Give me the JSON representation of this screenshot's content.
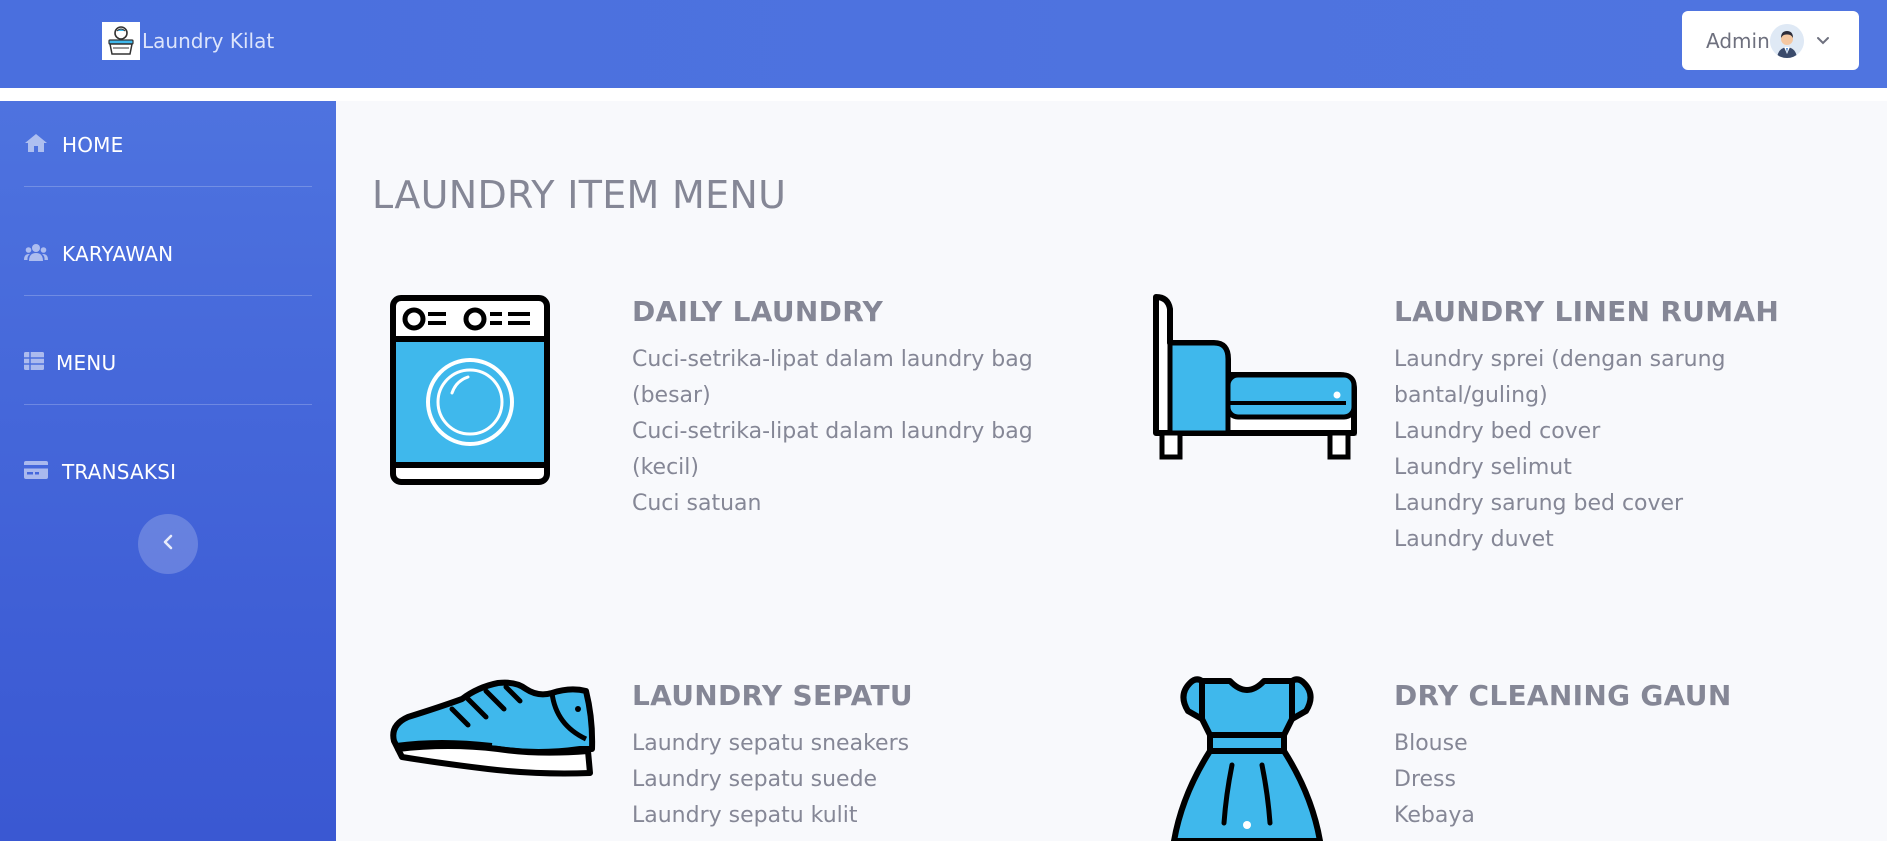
{
  "app": {
    "brand_name": "Laundry Kilat",
    "brand_icon": "laundry-basket-logo"
  },
  "topbar": {
    "user_name": "Admin",
    "avatar_icon": "user-avatar-icon",
    "caret_icon": "chevron-down-icon"
  },
  "sidebar": {
    "items": [
      {
        "label": "HOME",
        "icon": "home-icon"
      },
      {
        "label": "KARYAWAN",
        "icon": "users-icon"
      },
      {
        "label": "MENU",
        "icon": "table-icon"
      },
      {
        "label": "TRANSAKSI",
        "icon": "credit-card-icon"
      }
    ],
    "toggle_icon": "chevron-left-icon"
  },
  "main": {
    "title": "LAUNDRY ITEM MENU",
    "cards": [
      {
        "title": "DAILY LAUNDRY",
        "icon": "washing-machine-icon",
        "items": [
          "Cuci-setrika-lipat dalam laundry bag (besar)",
          "Cuci-setrika-lipat dalam laundry bag (kecil)",
          "Cuci satuan"
        ]
      },
      {
        "title": "LAUNDRY LINEN RUMAH",
        "icon": "bed-icon",
        "items": [
          "Laundry sprei (dengan sarung bantal/guling)",
          "Laundry bed cover",
          "Laundry selimut",
          "Laundry sarung bed cover",
          "Laundry duvet"
        ]
      },
      {
        "title": "LAUNDRY SEPATU",
        "icon": "sneaker-icon",
        "items": [
          "Laundry sepatu sneakers",
          "Laundry sepatu suede",
          "Laundry sepatu kulit"
        ]
      },
      {
        "title": "DRY CLEANING GAUN",
        "icon": "dress-icon",
        "items": [
          "Blouse",
          "Dress",
          "Kebaya"
        ]
      }
    ]
  },
  "colors": {
    "primary": "#4e73df",
    "icon_fill": "#3fb8ec",
    "text_muted": "#858796",
    "content_bg": "#f8f9fc"
  }
}
